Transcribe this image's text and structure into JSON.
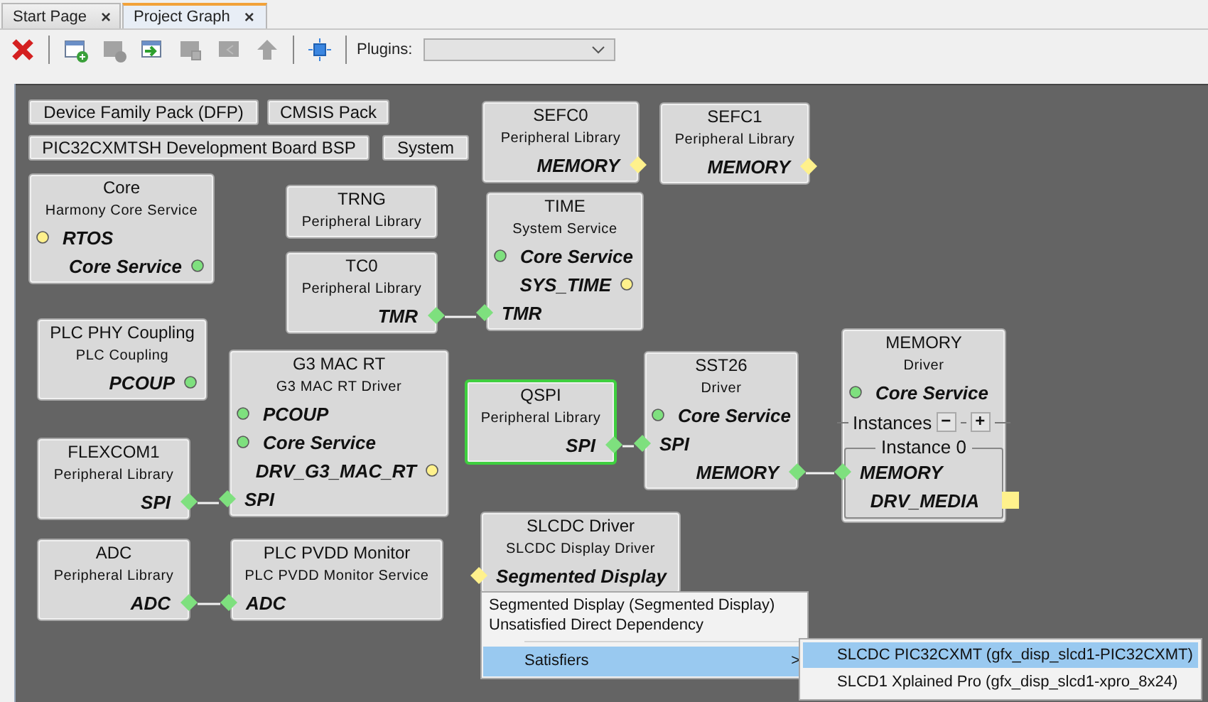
{
  "tabs": [
    {
      "label": "Start Page",
      "close": "×",
      "selected": false
    },
    {
      "label": "Project Graph",
      "close": "×",
      "selected": true
    }
  ],
  "toolbar": {
    "buttons": [
      {
        "kind": "delete",
        "disabled": false
      },
      {
        "kind": "add",
        "disabled": false
      },
      {
        "kind": "remove",
        "disabled": true
      },
      {
        "kind": "import",
        "disabled": false
      },
      {
        "kind": "square",
        "disabled": true
      },
      {
        "kind": "back",
        "disabled": true
      },
      {
        "kind": "up",
        "disabled": true
      },
      {
        "kind": "fit",
        "disabled": false
      }
    ],
    "plugins_label": "Plugins:"
  },
  "graph": {
    "packs": [
      {
        "label": "Device Family Pack (DFP)"
      },
      {
        "label": "CMSIS Pack"
      },
      {
        "label": "PIC32CXMTSH Development Board BSP"
      },
      {
        "label": "System"
      }
    ],
    "nodes": [
      {
        "title": "SEFC0",
        "subtitle": "Peripheral Library",
        "selected": false,
        "ports": [
          {
            "label": "MEMORY",
            "output": true,
            "kind": "diamond",
            "color": "#fff18c"
          }
        ]
      },
      {
        "title": "SEFC1",
        "subtitle": "Peripheral Library",
        "selected": false,
        "ports": [
          {
            "label": "MEMORY",
            "output": true,
            "kind": "diamond",
            "color": "#fff18c"
          }
        ]
      },
      {
        "title": "Core",
        "subtitle": "Harmony Core Service",
        "selected": false,
        "ports": [
          {
            "label": "RTOS",
            "output": false,
            "kind": "circle",
            "color": "#fff18c"
          },
          {
            "label": "Core Service",
            "output": true,
            "kind": "circle",
            "color": "#7ee07e"
          }
        ]
      },
      {
        "title": "TRNG",
        "subtitle": "Peripheral Library",
        "selected": false
      },
      {
        "title": "TC0",
        "subtitle": "Peripheral Library",
        "selected": false,
        "ports": [
          {
            "label": "TMR",
            "output": true,
            "kind": "diamond",
            "color": "#7ee07e"
          }
        ]
      },
      {
        "title": "TIME",
        "subtitle": "System Service",
        "selected": false,
        "ports": [
          {
            "label": "Core Service",
            "output": false,
            "kind": "circle",
            "color": "#7ee07e"
          },
          {
            "label": "SYS_TIME",
            "output": true,
            "kind": "circle",
            "color": "#fff18c"
          },
          {
            "label": "TMR",
            "output": false,
            "kind": "diamond",
            "color": "#7ee07e"
          }
        ]
      },
      {
        "title": "PLC PHY Coupling",
        "subtitle": "PLC Coupling",
        "selected": false,
        "ports": [
          {
            "label": "PCOUP",
            "output": true,
            "kind": "circle",
            "color": "#7ee07e"
          }
        ]
      },
      {
        "title": "FLEXCOM1",
        "subtitle": "Peripheral Library",
        "selected": false,
        "ports": [
          {
            "label": "SPI",
            "output": true,
            "kind": "diamond",
            "color": "#7ee07e"
          }
        ]
      },
      {
        "title": "G3 MAC RT",
        "subtitle": "G3 MAC RT Driver",
        "selected": false,
        "ports": [
          {
            "label": "PCOUP",
            "output": false,
            "kind": "circle",
            "color": "#7ee07e"
          },
          {
            "label": "Core Service",
            "output": false,
            "kind": "circle",
            "color": "#7ee07e"
          },
          {
            "label": "DRV_G3_MAC_RT",
            "output": true,
            "kind": "circle",
            "color": "#fff18c"
          },
          {
            "label": "SPI",
            "output": false,
            "kind": "diamond",
            "color": "#7ee07e"
          }
        ]
      },
      {
        "title": "QSPI",
        "subtitle": "Peripheral Library",
        "selected": true,
        "ports": [
          {
            "label": "SPI",
            "output": true,
            "kind": "diamond",
            "color": "#7ee07e"
          }
        ]
      },
      {
        "title": "SST26",
        "subtitle": "Driver",
        "selected": false,
        "ports": [
          {
            "label": "Core Service",
            "output": false,
            "kind": "circle",
            "color": "#7ee07e"
          },
          {
            "label": "SPI",
            "output": false,
            "kind": "diamond",
            "color": "#7ee07e"
          },
          {
            "label": "MEMORY",
            "output": true,
            "kind": "diamond",
            "color": "#7ee07e"
          }
        ]
      },
      {
        "title": "MEMORY",
        "subtitle": "Driver",
        "selected": false,
        "ports": [
          {
            "label": "Core Service",
            "output": false,
            "kind": "circle",
            "color": "#7ee07e"
          }
        ],
        "instances": {
          "label": "Instances",
          "buttons": [
            "−",
            "+"
          ],
          "groups": [
            {
              "label": "Instance 0",
              "ports": [
                {
                  "label": "MEMORY",
                  "output": false,
                  "kind": "diamond",
                  "color": "#7ee07e"
                },
                {
                  "label": "DRV_MEDIA",
                  "output": true,
                  "kind": "square",
                  "color": "#fff18c"
                }
              ]
            }
          ]
        }
      },
      {
        "title": "ADC",
        "subtitle": "Peripheral Library",
        "selected": false,
        "ports": [
          {
            "label": "ADC",
            "output": true,
            "kind": "diamond",
            "color": "#7ee07e"
          }
        ]
      },
      {
        "title": "PLC PVDD Monitor",
        "subtitle": "PLC PVDD Monitor Service",
        "selected": false,
        "ports": [
          {
            "label": "ADC",
            "output": false,
            "kind": "diamond",
            "color": "#7ee07e"
          }
        ]
      },
      {
        "title": "SLCDC Driver",
        "subtitle": "SLCDC Display Driver",
        "selected": false,
        "ports": [
          {
            "label": "Segmented Display",
            "output": false,
            "kind": "diamond",
            "color": "#fff18c"
          }
        ]
      }
    ],
    "context_menu": {
      "items": [
        {
          "kind": "text",
          "label": "Segmented Display (Segmented Display)"
        },
        {
          "kind": "text",
          "label": "Unsatisfied Direct Dependency"
        },
        {
          "kind": "submenu",
          "label": "Satisfiers",
          "arrow": ">",
          "selected": true
        }
      ],
      "submenu": {
        "items": [
          {
            "label": "SLCDC PIC32CXMT (gfx_disp_slcd1-PIC32CXMT)",
            "selected": true
          },
          {
            "label": "SLCD1 Xplained Pro (gfx_disp_slcd1-xpro_8x24)",
            "selected": false
          }
        ]
      }
    }
  }
}
